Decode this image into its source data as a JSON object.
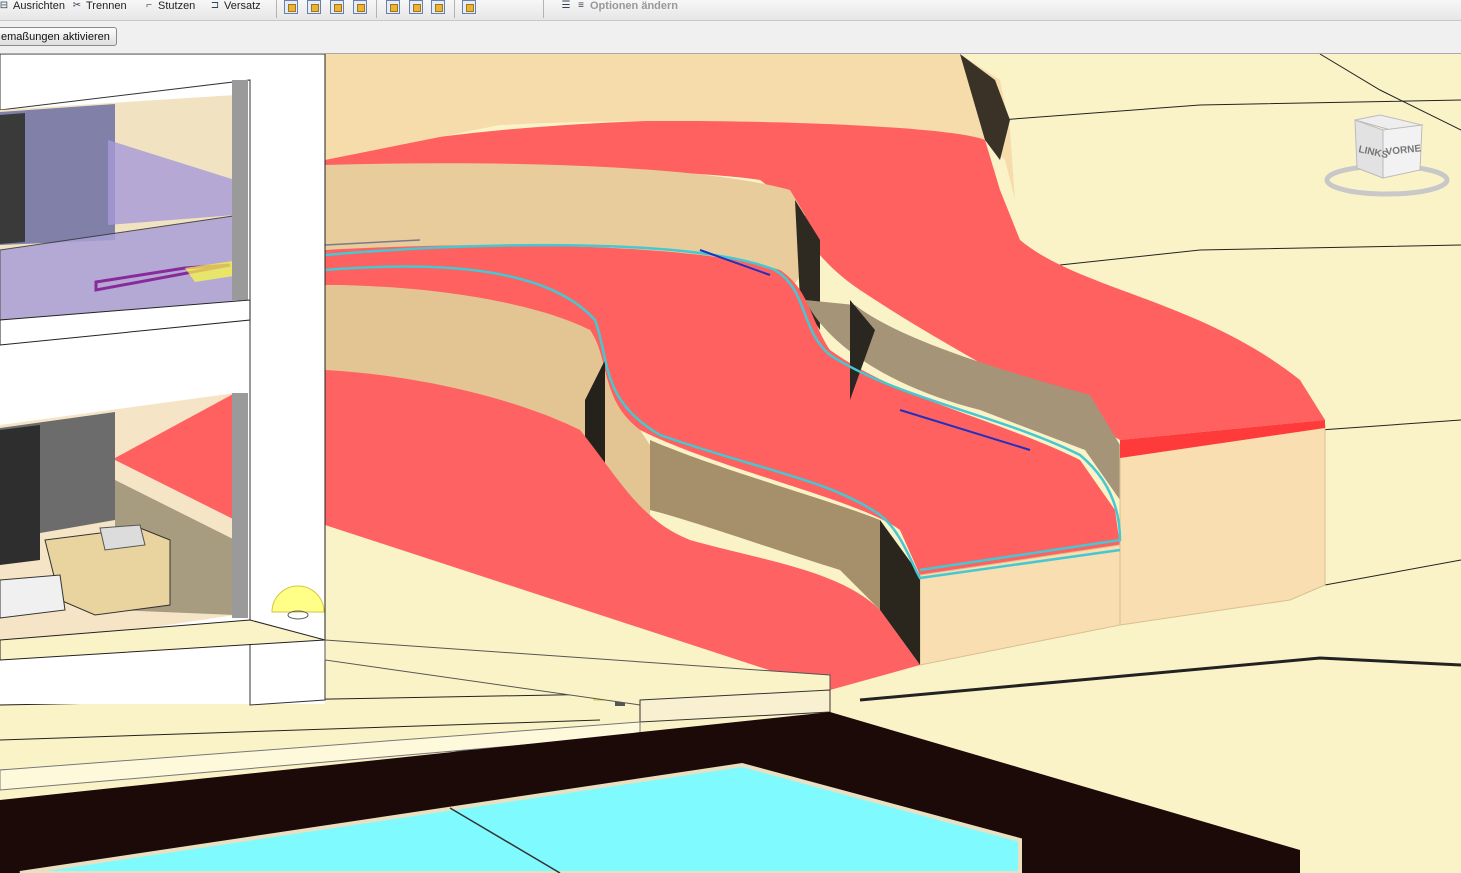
{
  "toolbar": {
    "ausrichten": "Ausrichten",
    "trennen": "Trennen",
    "stutzen": "Stutzen",
    "versatz": "Versatz",
    "optionen": "Optionen ändern"
  },
  "options_bar": {
    "button_label": "emaßungen aktivieren"
  },
  "viewcube": {
    "left_face": "LINKS",
    "front_face": "VORNE"
  },
  "colors": {
    "cut_red": "#ff5f5f",
    "wall_beige": "#f8deb0",
    "ground": "#fbf3c8",
    "pool_water": "#7ffbff",
    "pool_border": "#1c0a08",
    "highlight_cyan": "#46c8d2"
  },
  "icons": [
    "align-icon",
    "split-icon",
    "trim-icon",
    "offset-icon",
    "modify-icon",
    "options-icon",
    "viewcube-icon",
    "light-fixture-icon"
  ]
}
